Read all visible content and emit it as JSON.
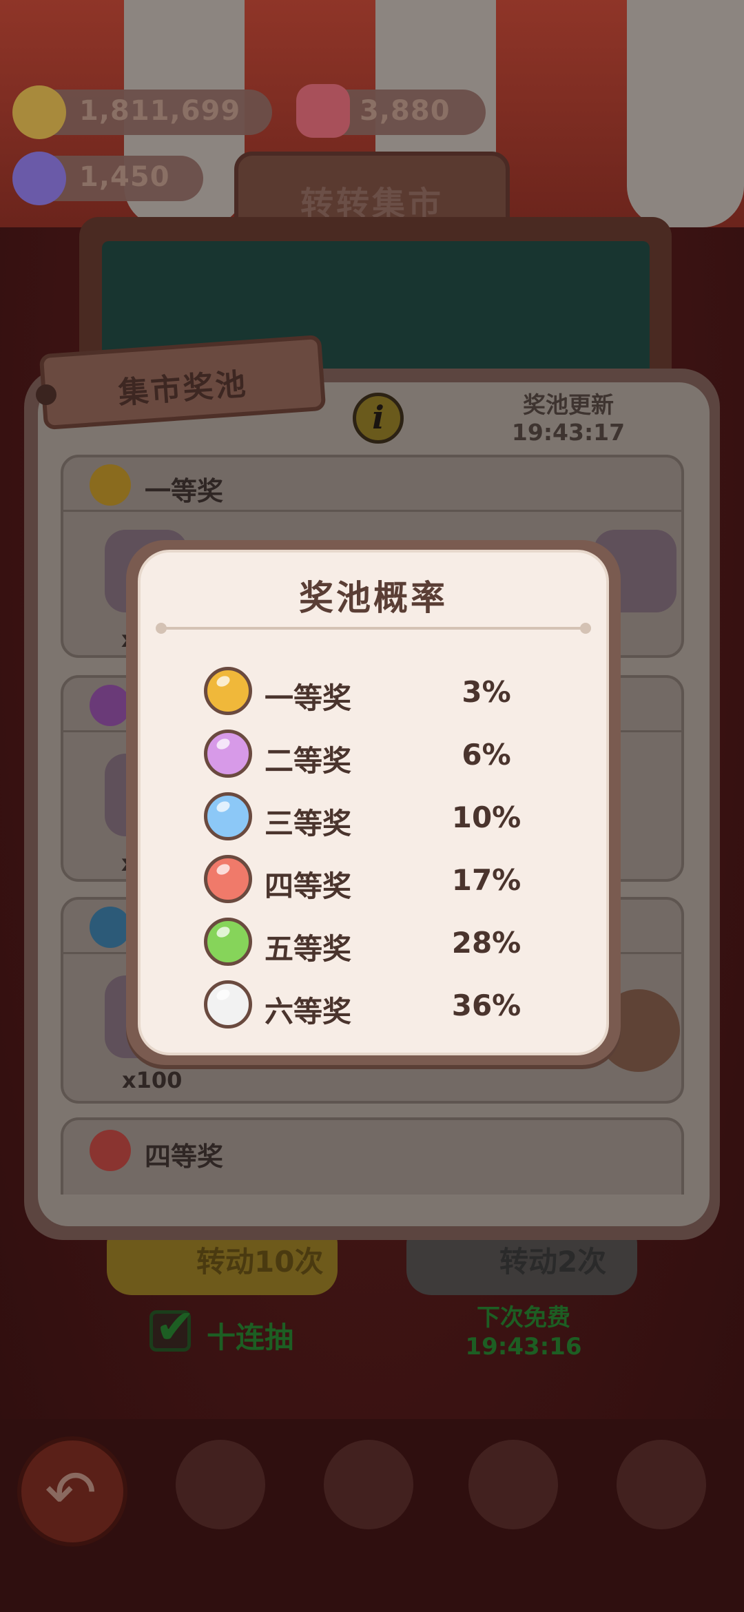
{
  "resources": [
    {
      "name": "coin",
      "value": "1,811,699",
      "color": "#a88a3c"
    },
    {
      "name": "ticket",
      "value": "3,880",
      "color": "#a8505a"
    },
    {
      "name": "candy",
      "value": "1,450",
      "color": "#6a5aa8"
    }
  ],
  "header": {
    "title": "转转集市"
  },
  "pool_panel": {
    "tag": "集市奖池",
    "info_icon": "i",
    "refresh_label": "奖池更新",
    "refresh_time": "19:43:17",
    "tiers": [
      {
        "name": "一等奖",
        "qty": "x",
        "color": "#8a6b1e"
      },
      {
        "name": "",
        "qty": "x",
        "color": "#6a3a78"
      },
      {
        "name": "",
        "qty": "x100",
        "color": "#2c5a78"
      },
      {
        "name": "四等奖",
        "qty": "",
        "color": "#8a3430"
      }
    ]
  },
  "controls": {
    "spin10_label": "转动10次",
    "spin2_label": "转动2次",
    "ten_pull_label": "十连抽",
    "next_free_label": "下次免费",
    "next_free_time": "19:43:16"
  },
  "dialog": {
    "title": "奖池概率",
    "rows": [
      {
        "name": "一等奖",
        "pct": "3%",
        "color": "#f0b83a"
      },
      {
        "name": "二等奖",
        "pct": "6%",
        "color": "#d79ae8"
      },
      {
        "name": "三等奖",
        "pct": "10%",
        "color": "#8cc8f7"
      },
      {
        "name": "四等奖",
        "pct": "17%",
        "color": "#f07a6a"
      },
      {
        "name": "五等奖",
        "pct": "28%",
        "color": "#86d45a"
      },
      {
        "name": "六等奖",
        "pct": "36%",
        "color": "#f2f2f2"
      }
    ]
  }
}
